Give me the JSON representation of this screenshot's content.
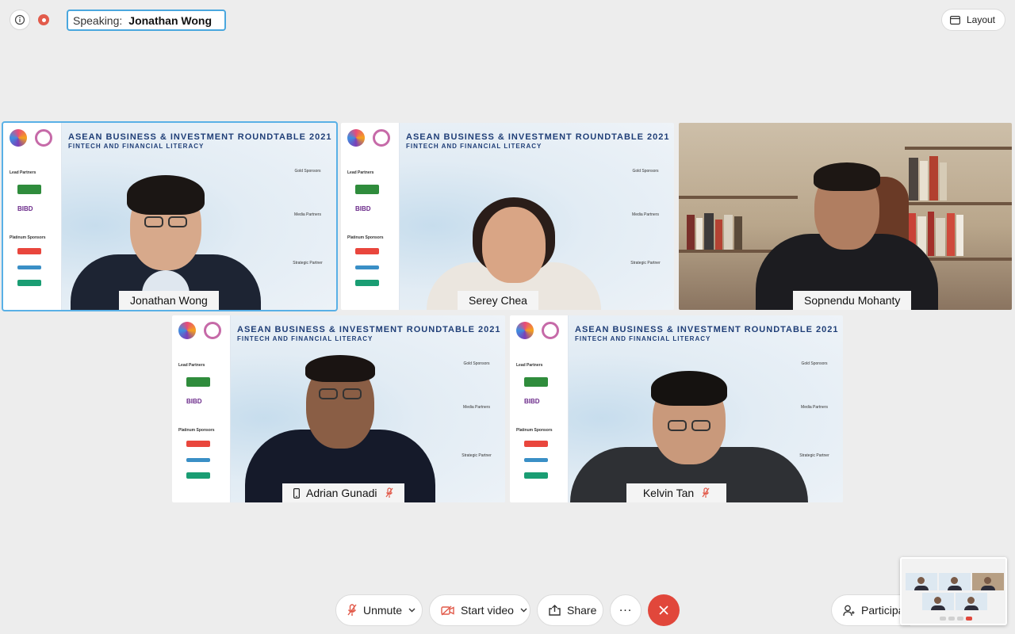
{
  "topbar": {
    "speaking_label": "Speaking:",
    "speaking_name": "Jonathan Wong",
    "layout_label": "Layout",
    "info_icon": "info-icon",
    "recording_icon": "recording-icon"
  },
  "banner": {
    "title": "ASEAN BUSINESS & INVESTMENT ROUNDTABLE 2021",
    "subtitle": "FINTECH AND FINANCIAL LITERACY",
    "lead_partners": "Lead Partners",
    "platinum_sponsors": "Platinum Sponsors",
    "gold_sponsors": "Gold Sponsors",
    "media_partners": "Media Partners",
    "strategic_partner": "Strategic Partner",
    "bibd": "BIBD"
  },
  "participants": [
    {
      "name": "Jonathan Wong",
      "muted": false,
      "active": true
    },
    {
      "name": "Serey Chea",
      "muted": false,
      "active": false
    },
    {
      "name": "Sopnendu Mohanty",
      "muted": false,
      "active": false
    },
    {
      "name": "Adrian Gunadi",
      "muted": true,
      "active": false,
      "phone": true
    },
    {
      "name": "Kelvin Tan",
      "muted": true,
      "active": false
    }
  ],
  "controls": {
    "unmute": "Unmute",
    "start_video": "Start video",
    "share": "Share",
    "more": "...",
    "participants": "Participa"
  },
  "colors": {
    "active_border": "#59b0e6",
    "end_call": "#e1473b",
    "muted_icon": "#e25b4b",
    "banner_title": "#1f3e77"
  }
}
